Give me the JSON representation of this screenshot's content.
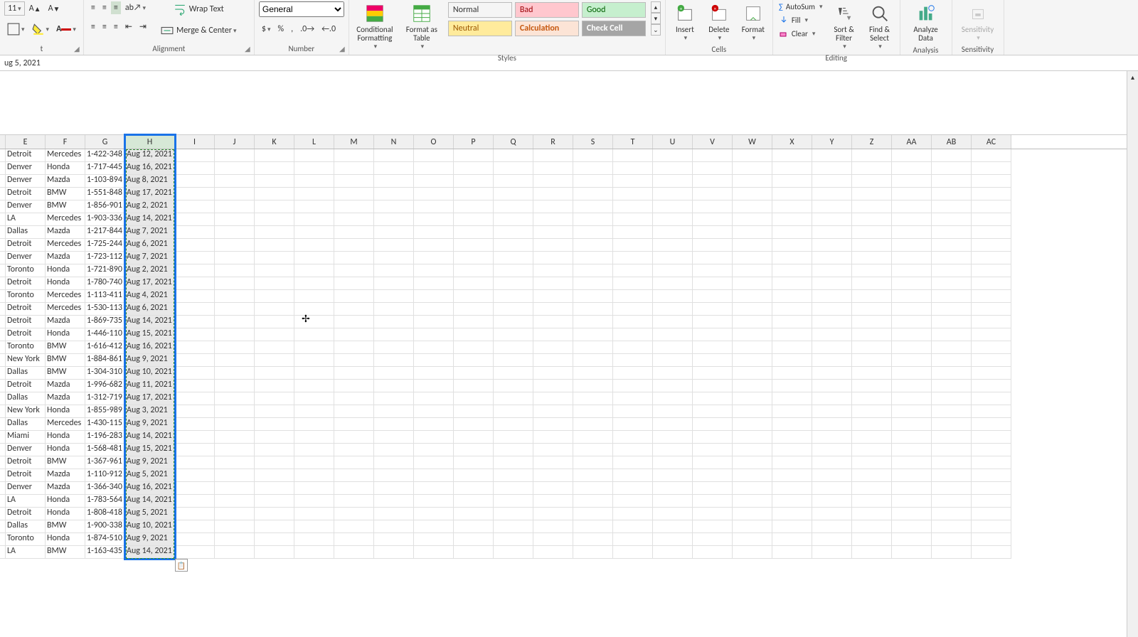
{
  "ribbon": {
    "font_size": "11",
    "wrap_text": "Wrap Text",
    "merge_center": "Merge & Center",
    "alignment_label": "Alignment",
    "number_format": "General",
    "number_label": "Number",
    "cond_fmt": "Conditional\nFormatting",
    "fmt_table": "Format as\nTable",
    "styles_label": "Styles",
    "style_normal": "Normal",
    "style_bad": "Bad",
    "style_good": "Good",
    "style_neutral": "Neutral",
    "style_calc": "Calculation",
    "style_check": "Check Cell",
    "insert": "Insert",
    "delete": "Delete",
    "format": "Format",
    "cells_label": "Cells",
    "autosum": "AutoSum",
    "fill": "Fill",
    "clear": "Clear",
    "sort_filter": "Sort &\nFilter",
    "find_select": "Find &\nSelect",
    "editing_label": "Editing",
    "analyze": "Analyze\nData",
    "analysis_label": "Analysis",
    "sensitivity": "Sensitivity",
    "sensitivity_label": "Sensitivity"
  },
  "formula_bar": "ug 5, 2021",
  "columns": [
    "E",
    "F",
    "G",
    "H",
    "I",
    "J",
    "K",
    "L",
    "M",
    "N",
    "O",
    "P",
    "Q",
    "R",
    "S",
    "T",
    "U",
    "V",
    "W",
    "X",
    "Y",
    "Z",
    "AA",
    "AB",
    "AC"
  ],
  "selected_column": "H",
  "rows": [
    {
      "e": "Detroit",
      "f": "Mercedes",
      "g": "1-422-348",
      "h": "Aug 12, 2021"
    },
    {
      "e": "Denver",
      "f": "Honda",
      "g": "1-717-445",
      "h": "Aug 16, 2021"
    },
    {
      "e": "Denver",
      "f": "Mazda",
      "g": "1-103-894",
      "h": "Aug 8, 2021"
    },
    {
      "e": "Detroit",
      "f": "BMW",
      "g": "1-551-848",
      "h": "Aug 17, 2021"
    },
    {
      "e": "Denver",
      "f": "BMW",
      "g": "1-856-901",
      "h": "Aug 2, 2021"
    },
    {
      "e": "LA",
      "f": "Mercedes",
      "g": "1-903-336",
      "h": "Aug 14, 2021"
    },
    {
      "e": "Dallas",
      "f": "Mazda",
      "g": "1-217-844",
      "h": "Aug 7, 2021"
    },
    {
      "e": "Detroit",
      "f": "Mercedes",
      "g": "1-725-244",
      "h": "Aug 6, 2021"
    },
    {
      "e": "Denver",
      "f": "Mazda",
      "g": "1-723-112",
      "h": "Aug 7, 2021"
    },
    {
      "e": "Toronto",
      "f": "Honda",
      "g": "1-721-890",
      "h": "Aug 2, 2021"
    },
    {
      "e": "Detroit",
      "f": "Honda",
      "g": "1-780-740",
      "h": "Aug 17, 2021"
    },
    {
      "e": "Toronto",
      "f": "Mercedes",
      "g": "1-113-411",
      "h": "Aug 4, 2021"
    },
    {
      "e": "Detroit",
      "f": "Mercedes",
      "g": "1-530-113",
      "h": "Aug 6, 2021"
    },
    {
      "e": "Detroit",
      "f": "Mazda",
      "g": "1-869-735",
      "h": "Aug 14, 2021"
    },
    {
      "e": "Detroit",
      "f": "Honda",
      "g": "1-446-110",
      "h": "Aug 15, 2021"
    },
    {
      "e": "Toronto",
      "f": "BMW",
      "g": "1-616-412",
      "h": "Aug 16, 2021"
    },
    {
      "e": "New York",
      "f": "BMW",
      "g": "1-884-861",
      "h": "Aug 9, 2021"
    },
    {
      "e": "Dallas",
      "f": "BMW",
      "g": "1-304-310",
      "h": "Aug 10, 2021"
    },
    {
      "e": "Detroit",
      "f": "Mazda",
      "g": "1-996-682",
      "h": "Aug 11, 2021"
    },
    {
      "e": "Dallas",
      "f": "Mazda",
      "g": "1-312-719",
      "h": "Aug 17, 2021"
    },
    {
      "e": "New York",
      "f": "Honda",
      "g": "1-855-989",
      "h": "Aug 3, 2021"
    },
    {
      "e": "Dallas",
      "f": "Mercedes",
      "g": "1-430-115",
      "h": "Aug 9, 2021"
    },
    {
      "e": "Miami",
      "f": "Honda",
      "g": "1-196-283",
      "h": "Aug 14, 2021"
    },
    {
      "e": "Denver",
      "f": "Honda",
      "g": "1-568-481",
      "h": "Aug 15, 2021"
    },
    {
      "e": "Detroit",
      "f": "BMW",
      "g": "1-367-961",
      "h": "Aug 9, 2021"
    },
    {
      "e": "Detroit",
      "f": "Mazda",
      "g": "1-110-912",
      "h": "Aug 5, 2021"
    },
    {
      "e": "Denver",
      "f": "Mazda",
      "g": "1-366-340",
      "h": "Aug 16, 2021"
    },
    {
      "e": "LA",
      "f": "Honda",
      "g": "1-783-564",
      "h": "Aug 14, 2021"
    },
    {
      "e": "Detroit",
      "f": "Honda",
      "g": "1-808-418",
      "h": "Aug 5, 2021"
    },
    {
      "e": "Dallas",
      "f": "BMW",
      "g": "1-900-338",
      "h": "Aug 10, 2021"
    },
    {
      "e": "Toronto",
      "f": "Honda",
      "g": "1-874-510",
      "h": "Aug 9, 2021"
    },
    {
      "e": "LA",
      "f": "BMW",
      "g": "1-163-435",
      "h": "Aug 14, 2021"
    }
  ]
}
